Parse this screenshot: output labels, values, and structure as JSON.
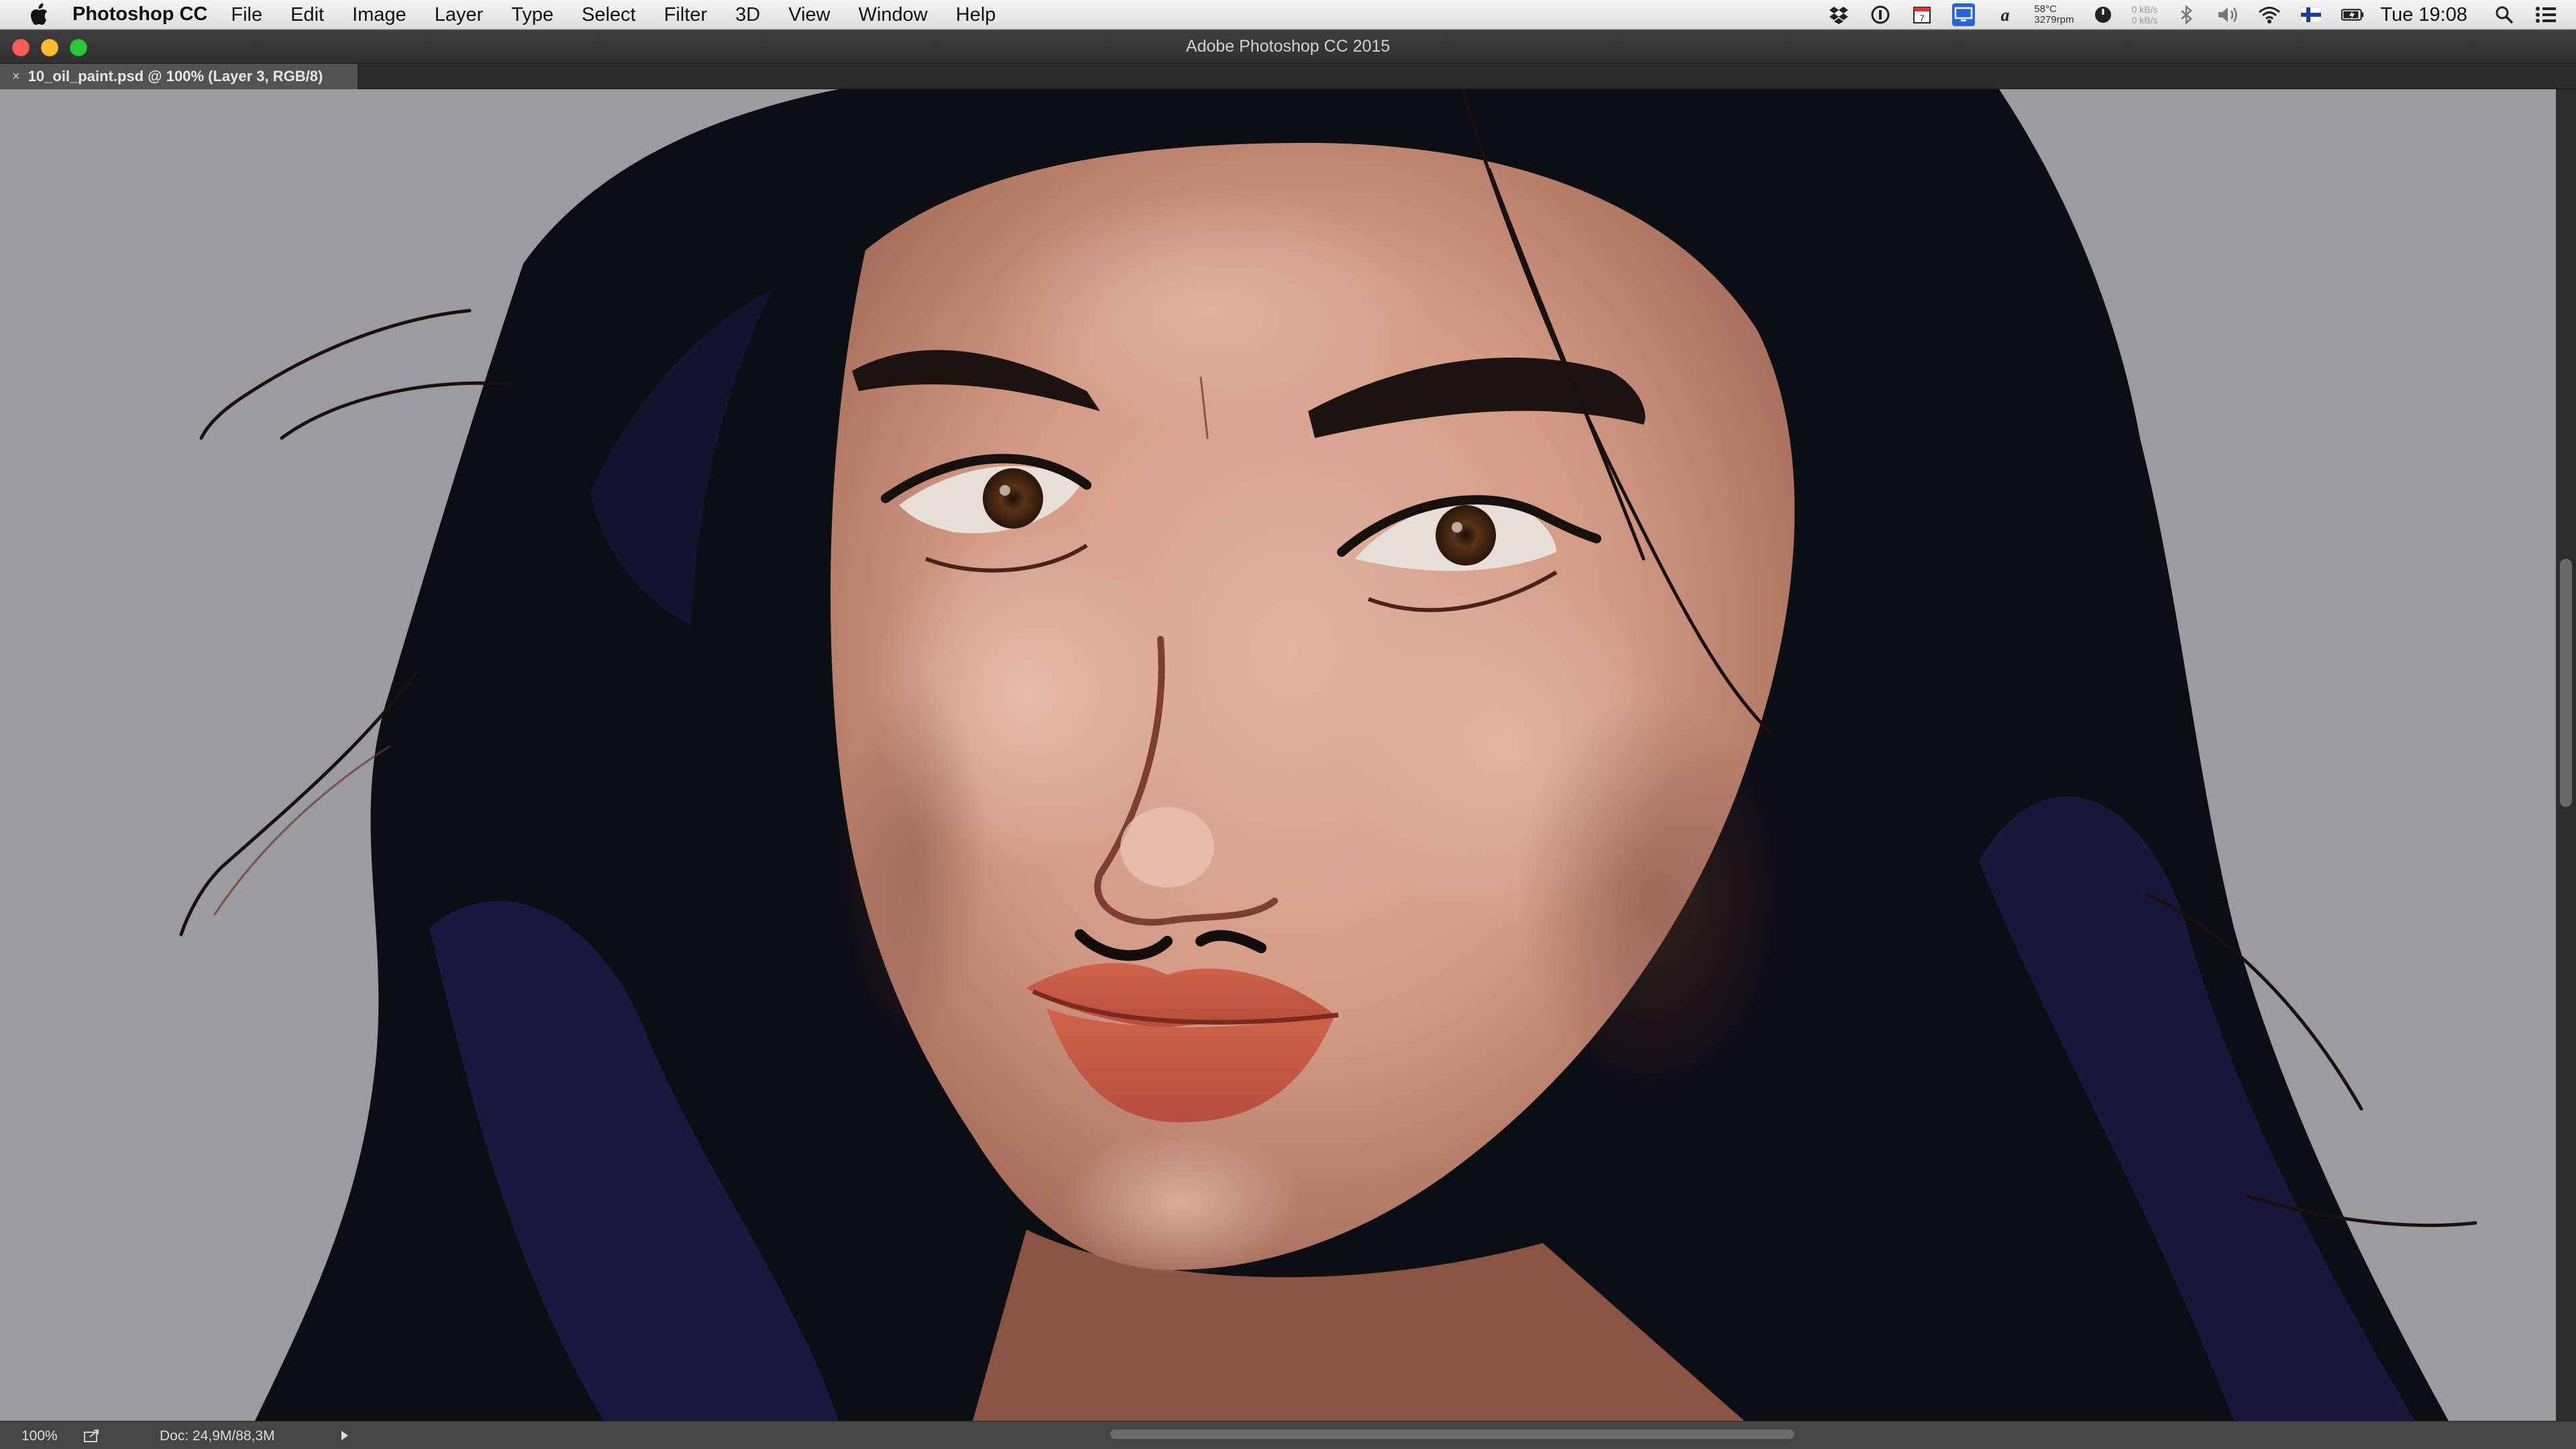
{
  "menubar": {
    "app_name": "Photoshop CC",
    "items": [
      "File",
      "Edit",
      "Image",
      "Layer",
      "Type",
      "Select",
      "Filter",
      "3D",
      "View",
      "Window",
      "Help"
    ],
    "status": {
      "temperature": "58°C",
      "fan_speed": "3279rpm",
      "net_up": "0 kB/s",
      "net_down": "0 kB/s",
      "calendar_day": "7",
      "clock": "Tue 19:08"
    }
  },
  "window": {
    "title": "Adobe Photoshop CC 2015"
  },
  "document": {
    "tab_close_glyph": "×",
    "tab_label": "10_oil_paint.psd @ 100% (Layer 3, RGB/8)"
  },
  "statusbar": {
    "zoom": "100%",
    "doc_info": "Doc: 24,9M/88,3M"
  },
  "icons": {
    "menubar": [
      "apple-icon"
    ],
    "status": [
      "dropbox-icon",
      "onepassword-icon",
      "calendar-icon",
      "display-icon",
      "alfred-icon",
      "temperature-text",
      "timer-icon",
      "network-speed-text",
      "bluetooth-icon",
      "volume-icon",
      "wifi-icon",
      "flag-icon",
      "battery-icon",
      "spotlight-icon",
      "notification-center-icon"
    ]
  },
  "colors": {
    "canvas_background": "#9b9ba0",
    "skin": "#d29a86",
    "hair": "#0d0d14",
    "hair_blue": "#1b1c48",
    "lips": "#c45a45",
    "eyes": "#4a2a14"
  }
}
